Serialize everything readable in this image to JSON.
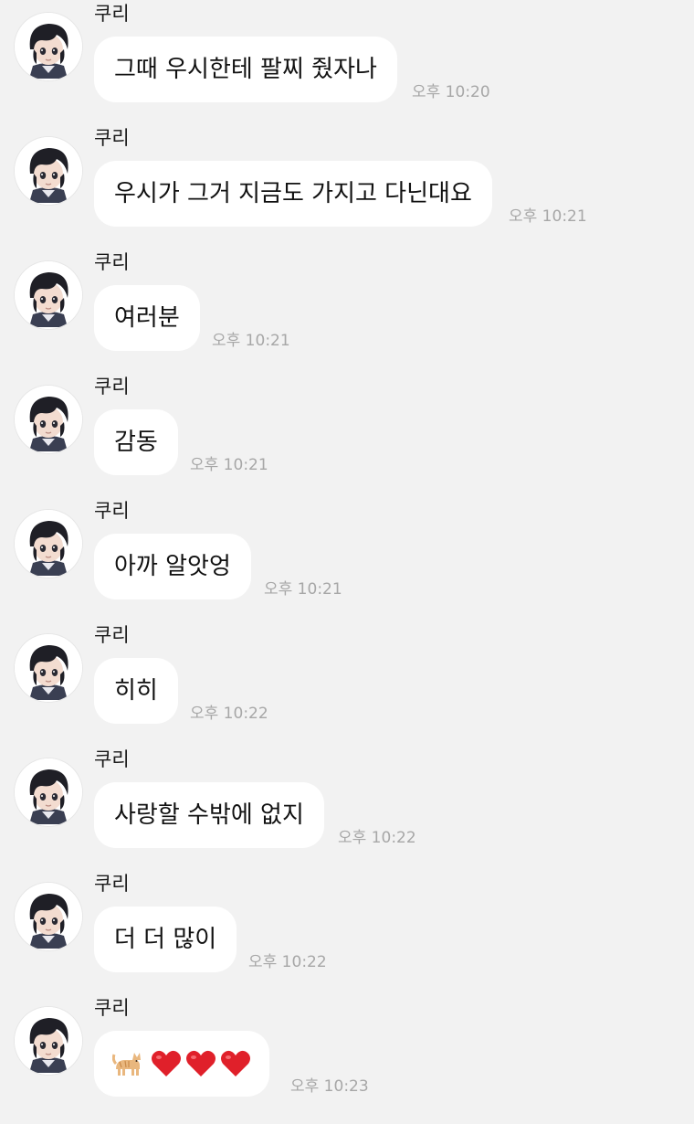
{
  "messages": [
    {
      "sender": "쿠리",
      "text": "그때 우시한테 팔찌 줬자나",
      "time": "오후 10:20"
    },
    {
      "sender": "쿠리",
      "text": "우시가 그거 지금도 가지고 다닌대요",
      "time": "오후 10:21"
    },
    {
      "sender": "쿠리",
      "text": "여러분",
      "time": "오후 10:21"
    },
    {
      "sender": "쿠리",
      "text": "감동",
      "time": "오후 10:21"
    },
    {
      "sender": "쿠리",
      "text": "아까 알앗엉",
      "time": "오후 10:21"
    },
    {
      "sender": "쿠리",
      "text": "히히",
      "time": "오후 10:22"
    },
    {
      "sender": "쿠리",
      "text": "사랑할 수밖에 없지",
      "time": "오후 10:22"
    },
    {
      "sender": "쿠리",
      "text": "더 더 많이",
      "time": "오후 10:22"
    },
    {
      "sender": "쿠리",
      "text": "",
      "emojis": [
        "cat-emoji",
        "red-heart-emoji",
        "red-heart-emoji",
        "red-heart-emoji"
      ],
      "time": "오후 10:23"
    }
  ],
  "colors": {
    "background": "#f2f2f2",
    "bubble": "#ffffff",
    "text": "#111111",
    "time": "#a7a7a7",
    "heart": "#e0202a"
  }
}
